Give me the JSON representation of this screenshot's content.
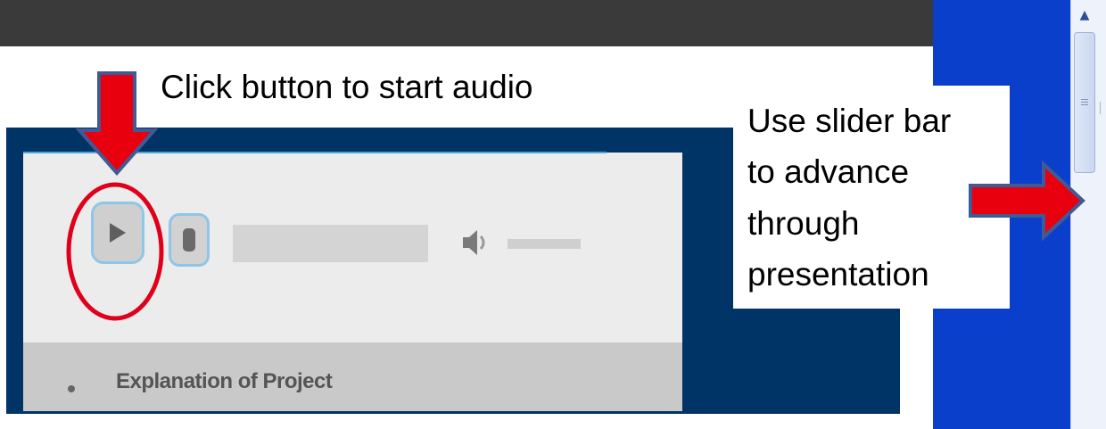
{
  "callouts": {
    "audio_instruction": "Click button to start audio",
    "slider_instruction_lines": [
      "Use slider bar",
      "to advance",
      "through",
      "presentation"
    ]
  },
  "player": {
    "menu_items": [
      {
        "label": "Explanation of Project"
      }
    ]
  },
  "icons": {
    "play": "play-icon",
    "stop": "stop-icon",
    "volume": "volume-icon",
    "scroll_up": "chevron-up-icon"
  },
  "colors": {
    "arrow_fill": "#e8000f",
    "arrow_stroke": "#3f5a94",
    "highlight_ellipse": "#e0001b",
    "slide_background": "#003366",
    "blue_panel": "#0a3fcc"
  }
}
